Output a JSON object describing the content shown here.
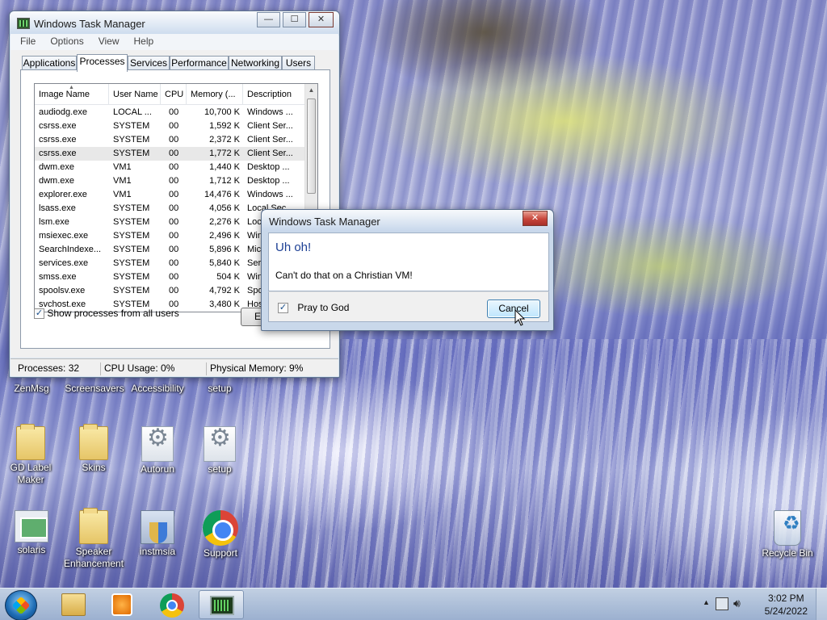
{
  "desktop": {
    "icons": [
      {
        "label": "ZenMsg"
      },
      {
        "label": "Screensavers"
      },
      {
        "label": "Accessibility"
      },
      {
        "label": "setup"
      },
      {
        "label": "GD Label Maker"
      },
      {
        "label": "Skins"
      },
      {
        "label": "Autorun"
      },
      {
        "label": "setup"
      },
      {
        "label": "solaris"
      },
      {
        "label": "Speaker Enhancement"
      },
      {
        "label": "instmsia"
      },
      {
        "label": "Support"
      },
      {
        "label": "Recycle Bin"
      }
    ]
  },
  "taskmgr": {
    "title": "Windows Task Manager",
    "menu": [
      "File",
      "Options",
      "View",
      "Help"
    ],
    "tabs": [
      "Applications",
      "Processes",
      "Services",
      "Performance",
      "Networking",
      "Users"
    ],
    "active_tab": "Processes",
    "columns": [
      "Image Name",
      "User Name",
      "CPU",
      "Memory (...",
      "Description"
    ],
    "rows": [
      [
        "audiodg.exe",
        "LOCAL ...",
        "00",
        "10,700 K",
        "Windows ..."
      ],
      [
        "csrss.exe",
        "SYSTEM",
        "00",
        "1,592 K",
        "Client Ser..."
      ],
      [
        "csrss.exe",
        "SYSTEM",
        "00",
        "2,372 K",
        "Client Ser..."
      ],
      [
        "csrss.exe",
        "SYSTEM",
        "00",
        "1,772 K",
        "Client Ser..."
      ],
      [
        "dwm.exe",
        "VM1",
        "00",
        "1,440 K",
        "Desktop ..."
      ],
      [
        "dwm.exe",
        "VM1",
        "00",
        "1,712 K",
        "Desktop ..."
      ],
      [
        "explorer.exe",
        "VM1",
        "00",
        "14,476 K",
        "Windows ..."
      ],
      [
        "lsass.exe",
        "SYSTEM",
        "00",
        "4,056 K",
        "Local Sec..."
      ],
      [
        "lsm.exe",
        "SYSTEM",
        "00",
        "2,276 K",
        "Loc..."
      ],
      [
        "msiexec.exe",
        "SYSTEM",
        "00",
        "2,496 K",
        "Win..."
      ],
      [
        "SearchIndexe...",
        "SYSTEM",
        "00",
        "5,896 K",
        "Mic..."
      ],
      [
        "services.exe",
        "SYSTEM",
        "00",
        "5,840 K",
        "Ser..."
      ],
      [
        "smss.exe",
        "SYSTEM",
        "00",
        "504 K",
        "Win..."
      ],
      [
        "spoolsv.exe",
        "SYSTEM",
        "00",
        "4,792 K",
        "Spo..."
      ],
      [
        "svchost.exe",
        "SYSTEM",
        "00",
        "3,480 K",
        "Hos..."
      ]
    ],
    "show_all_label": "Show processes from all users",
    "show_all_checked": true,
    "end_process_label": "E",
    "status": {
      "processes": "Processes: 32",
      "cpu": "CPU Usage: 0%",
      "memory": "Physical Memory: 9%"
    },
    "caption_buttons": {
      "minimize": "—",
      "maximize": "☐",
      "close": "✕"
    }
  },
  "dialog": {
    "title": "Windows Task Manager",
    "instruction": "Uh oh!",
    "message": "Can't do that on a Christian VM!",
    "checkbox_label": "Pray to God",
    "checkbox_checked": true,
    "cancel_label": "Cancel",
    "close_glyph": "✕"
  },
  "taskbar": {
    "pinned": [
      "Windows Explorer",
      "Windows Media Player",
      "Google Chrome",
      "Windows Task Manager"
    ],
    "clock_time": "3:02 PM",
    "clock_date": "5/24/2022"
  },
  "colors": {
    "dialog_instruction": "#1c3f94",
    "close_button": "#c8463b"
  }
}
